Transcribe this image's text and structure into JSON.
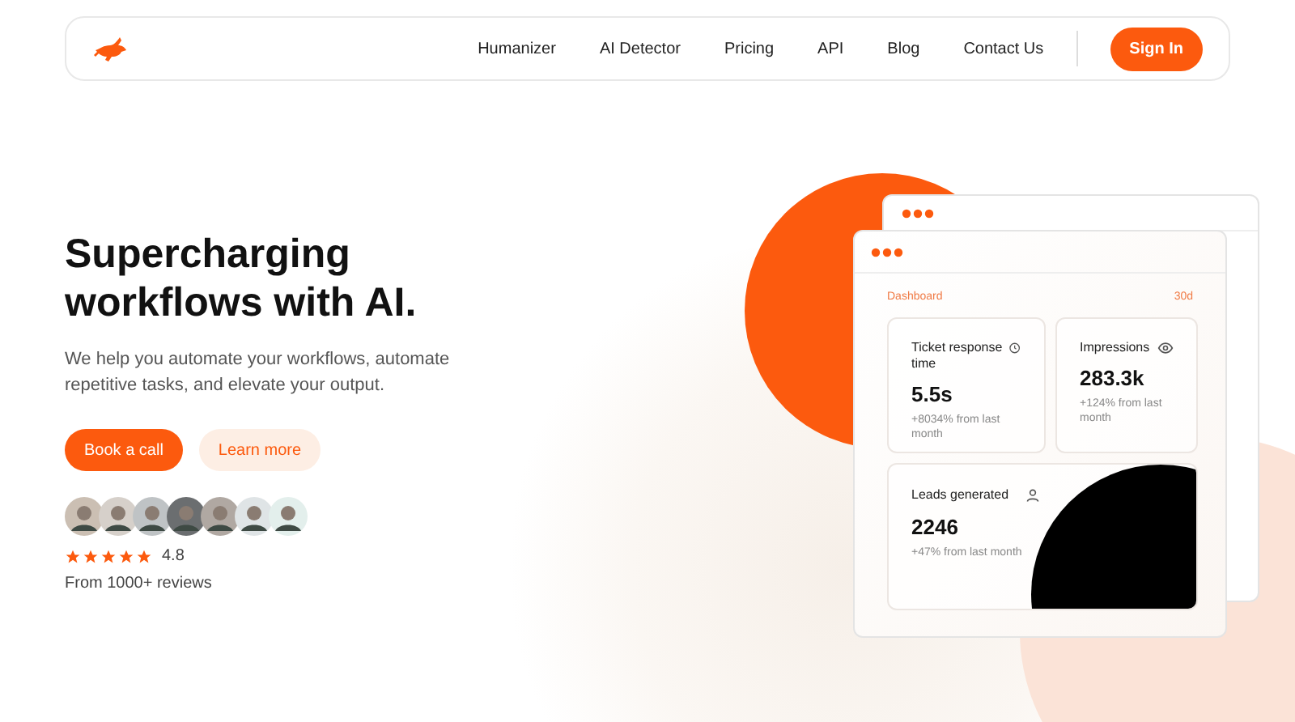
{
  "nav": {
    "links": [
      "Humanizer",
      "AI Detector",
      "Pricing",
      "API",
      "Blog",
      "Contact Us"
    ],
    "cta": "Sign In"
  },
  "hero": {
    "title": "Supercharging workflows with AI.",
    "subtitle": "We help you automate your workflows, automate repetitive tasks, and elevate your output.",
    "primary_button": "Book a call",
    "secondary_button": "Learn more",
    "rating": {
      "stars": 5,
      "score": "4.8",
      "reviews": "From 1000+ reviews"
    }
  },
  "dashboard": {
    "title": "Dashboard",
    "period": "30d",
    "metrics": [
      {
        "label": "Ticket response time",
        "value": "5.5s",
        "change": "+8034% from last month"
      },
      {
        "label": "Impressions",
        "value": "283.3k",
        "change": "+124% from last month"
      },
      {
        "label": "Leads generated",
        "value": "2246",
        "change": "+47% from last month"
      }
    ]
  }
}
